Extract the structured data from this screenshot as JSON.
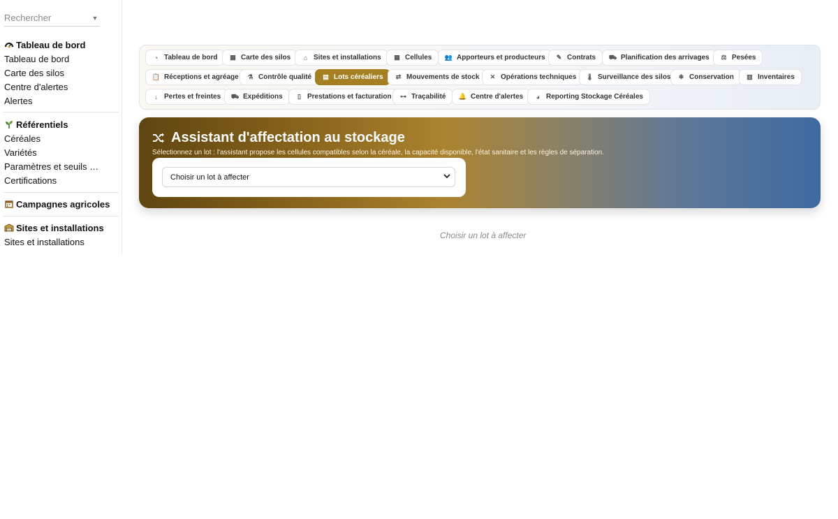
{
  "sidebar": {
    "search_placeholder": "Rechercher",
    "sections": [
      {
        "title": "Tableau de bord",
        "icon": "gauge-icon",
        "items": [
          "Tableau de bord",
          "Carte des silos",
          "Centre d'alertes",
          "Alertes"
        ]
      },
      {
        "title": "Référentiels",
        "icon": "sprout-icon",
        "items": [
          "Céréales",
          "Variétés",
          "Paramètres et seuils qual…",
          "Certifications"
        ]
      },
      {
        "title": "Campagnes agricoles",
        "icon": "calendar-icon",
        "items": []
      },
      {
        "title": "Sites et installations",
        "icon": "warehouse-icon",
        "items": [
          "Sites et installations"
        ]
      }
    ]
  },
  "nav": {
    "buttons": [
      {
        "label": "Tableau de bord",
        "icon": "gauge-icon"
      },
      {
        "label": "Carte des silos",
        "icon": "grid-icon"
      },
      {
        "label": "Sites et installations",
        "icon": "warehouse-icon"
      },
      {
        "label": "Cellules",
        "icon": "grid-icon"
      },
      {
        "label": "Apporteurs et producteurs",
        "icon": "users-icon"
      },
      {
        "label": "Contrats",
        "icon": "contract-icon"
      },
      {
        "label": "Planification des arrivages",
        "icon": "truck-ramp-icon"
      },
      {
        "label": "Pesées",
        "icon": "scale-icon"
      },
      {
        "label": "Réceptions et agréage",
        "icon": "clipboard-check-icon"
      },
      {
        "label": "Contrôle qualité",
        "icon": "flask-icon"
      },
      {
        "label": "Lots céréaliers",
        "icon": "box-icon"
      },
      {
        "label": "Mouvements de stock",
        "icon": "arrows-exchange-icon"
      },
      {
        "label": "Opérations techniques",
        "icon": "tools-icon"
      },
      {
        "label": "Surveillance des silos",
        "icon": "thermometer-icon"
      },
      {
        "label": "Conservation",
        "icon": "snowflake-icon"
      },
      {
        "label": "Inventaires",
        "icon": "clipboard-list-icon"
      },
      {
        "label": "Pertes et freintes",
        "icon": "arrow-down-icon"
      },
      {
        "label": "Expéditions",
        "icon": "truck-icon"
      },
      {
        "label": "Prestations et facturation",
        "icon": "invoice-icon"
      },
      {
        "label": "Traçabilité",
        "icon": "sitemap-icon"
      },
      {
        "label": "Centre d'alertes",
        "icon": "bell-icon"
      },
      {
        "label": "Reporting Stockage Céréales",
        "icon": "pie-chart-icon"
      }
    ],
    "active": "Lots céréaliers",
    "active_color": "#a67f22"
  },
  "hero": {
    "title": "Assistant d'affectation au stockage",
    "icon": "shuffle-icon",
    "subtitle": "Sélectionnez un lot : l'assistant propose les cellules compatibles selon la céréale, la capacité disponible, l'état sanitaire et les règles de séparation.",
    "select_value": "Choisir un lot à affecter"
  },
  "empty_state": "Choisir un lot à affecter"
}
